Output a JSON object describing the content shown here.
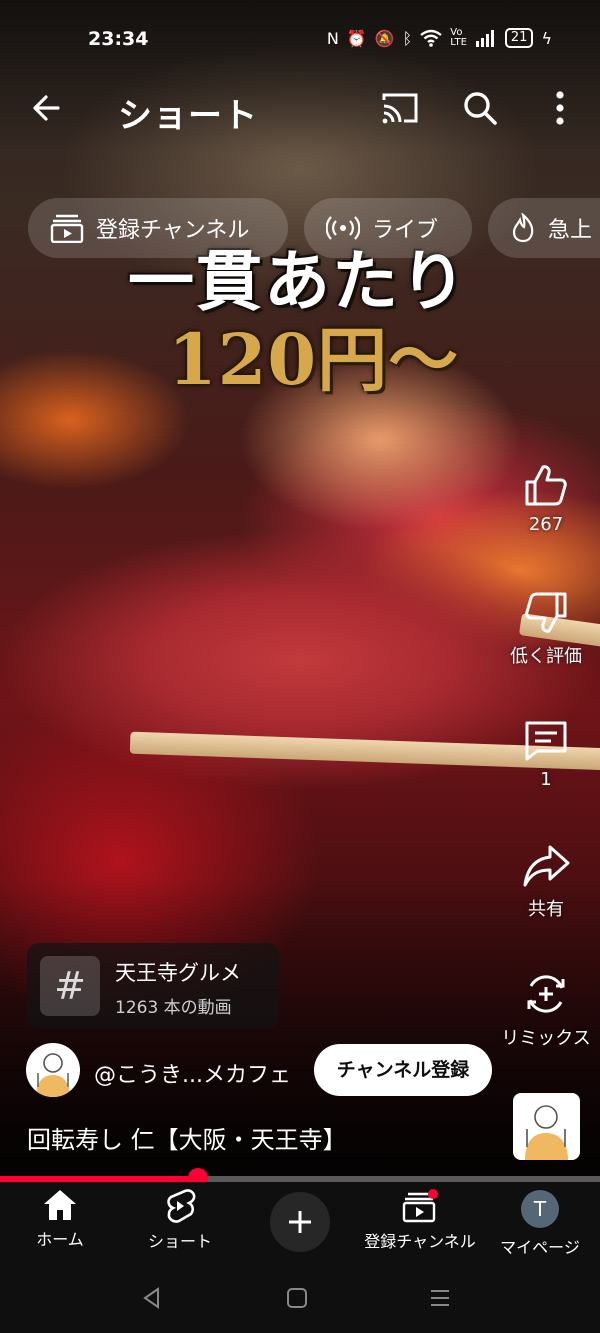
{
  "status_bar": {
    "time": "23:34",
    "battery": "21",
    "icons": [
      "nfc-icon",
      "alarm-icon",
      "mute-icon",
      "bluetooth-icon",
      "wifi-icon",
      "volte-icon",
      "signal-icon",
      "charging-icon"
    ]
  },
  "topbar": {
    "title": "ショート",
    "icons": [
      "back-arrow-icon",
      "cast-icon",
      "search-icon",
      "more-vert-icon"
    ]
  },
  "chips": [
    {
      "label": "登録チャンネル",
      "icon": "subscriptions-icon"
    },
    {
      "label": "ライブ",
      "icon": "live-icon"
    },
    {
      "label": "急上",
      "icon": "trending-icon"
    }
  ],
  "video_overlay": {
    "line1": "一貫あたり",
    "line2": "120円〜"
  },
  "actions": {
    "like_count": "267",
    "dislike_label": "低く評価",
    "comment_count": "1",
    "share_label": "共有",
    "remix_label": "リミックス"
  },
  "hashtag": {
    "symbol": "#",
    "name": "天王寺グルメ",
    "count": "1263 本の動画"
  },
  "channel": {
    "handle": "@こうき...メカフェ",
    "subscribe_label": "チャンネル登録"
  },
  "video_title": "回転寿し 仁【大阪・天王寺】",
  "progress": {
    "fraction": 0.33
  },
  "bottom_nav": {
    "home": "ホーム",
    "shorts": "ショート",
    "create": "+",
    "subscriptions": "登録チャンネル",
    "mypage": "マイページ",
    "avatar_letter": "T"
  },
  "colors": {
    "accent": "#ff0033",
    "nav_background": "#0f0f0f",
    "caption_gold": "#d7a74b"
  }
}
